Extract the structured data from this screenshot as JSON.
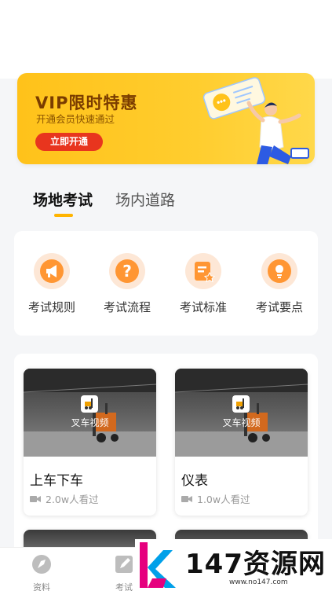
{
  "banner": {
    "title": "VIP限时特惠",
    "subtitle": "开通会员快速通过",
    "button": "立即开通",
    "colors": {
      "background": "#ffc21a",
      "title": "#7a3c00",
      "button": "#e8351e"
    }
  },
  "tabs": [
    {
      "label": "场地考试",
      "active": true
    },
    {
      "label": "场内道路",
      "active": false
    }
  ],
  "categories": [
    {
      "label": "考试规则",
      "icon": "megaphone-icon"
    },
    {
      "label": "考试流程",
      "icon": "question-icon"
    },
    {
      "label": "考试标准",
      "icon": "document-star-icon"
    },
    {
      "label": "考试要点",
      "icon": "lightbulb-icon"
    }
  ],
  "videos": [
    {
      "tag": "叉车视频",
      "title": "上车下车",
      "views": "2.0w人看过"
    },
    {
      "tag": "叉车视频",
      "title": "仪表",
      "views": "1.0w人看过"
    }
  ],
  "bottom_nav": [
    {
      "label": "资料",
      "icon": "compass-icon"
    },
    {
      "label": "考试",
      "icon": "edit-icon"
    }
  ],
  "watermark": {
    "text": "147资源网",
    "url": "www.no147.com"
  }
}
